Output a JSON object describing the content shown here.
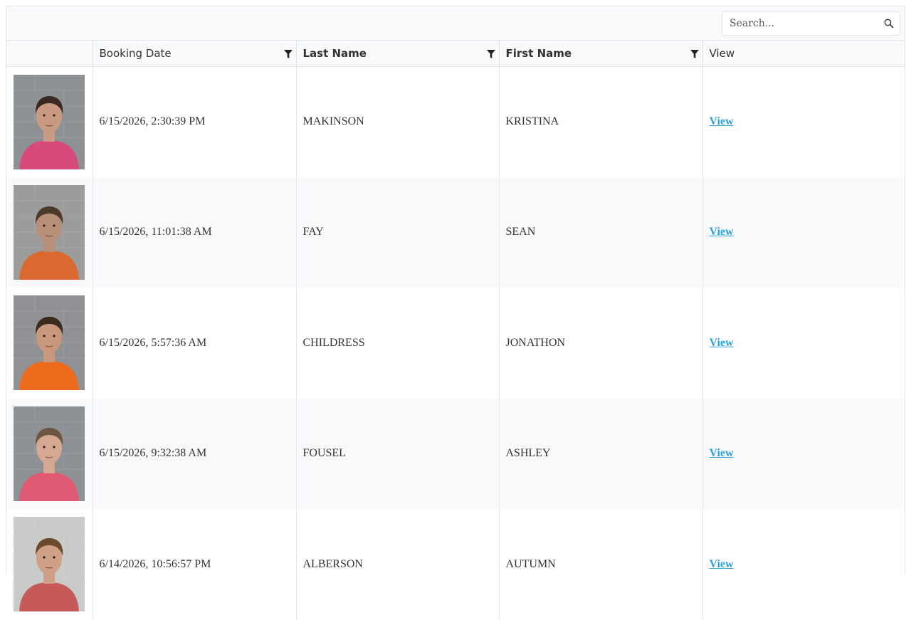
{
  "search": {
    "placeholder": "Search..."
  },
  "columns": {
    "booking_date": "Booking Date",
    "last_name": "Last Name",
    "first_name": "First Name",
    "view": "View"
  },
  "rows": [
    {
      "booking_date": "6/15/2026, 2:30:39 PM",
      "last_name": "MAKINSON",
      "first_name": "KRISTINA",
      "view": "View",
      "bg": "#8e9194",
      "shirt": "#d64b7c",
      "skin": "#c99a82",
      "hair": "#3a2a22"
    },
    {
      "booking_date": "6/15/2026, 11:01:38 AM",
      "last_name": "FAY",
      "first_name": "SEAN",
      "view": "View",
      "bg": "#9c9c9a",
      "shirt": "#d9692e",
      "skin": "#b89079",
      "hair": "#4a3a2c"
    },
    {
      "booking_date": "6/15/2026, 5:57:36 AM",
      "last_name": "CHILDRESS",
      "first_name": "JONATHON",
      "view": "View",
      "bg": "#8f9194",
      "shirt": "#ee6b1e",
      "skin": "#c9977b",
      "hair": "#3b2b1f"
    },
    {
      "booking_date": "6/15/2026, 9:32:38 AM",
      "last_name": "FOUSEL",
      "first_name": "ASHLEY",
      "view": "View",
      "bg": "#8d9095",
      "shirt": "#e05a73",
      "skin": "#d4a892",
      "hair": "#6d5644"
    },
    {
      "booking_date": "6/14/2026, 10:56:57 PM",
      "last_name": "ALBERSON",
      "first_name": "AUTUMN",
      "view": "View",
      "bg": "#c9cbc8",
      "shirt": "#c65a5a",
      "skin": "#cf9f86",
      "hair": "#6b4a2c"
    }
  ]
}
